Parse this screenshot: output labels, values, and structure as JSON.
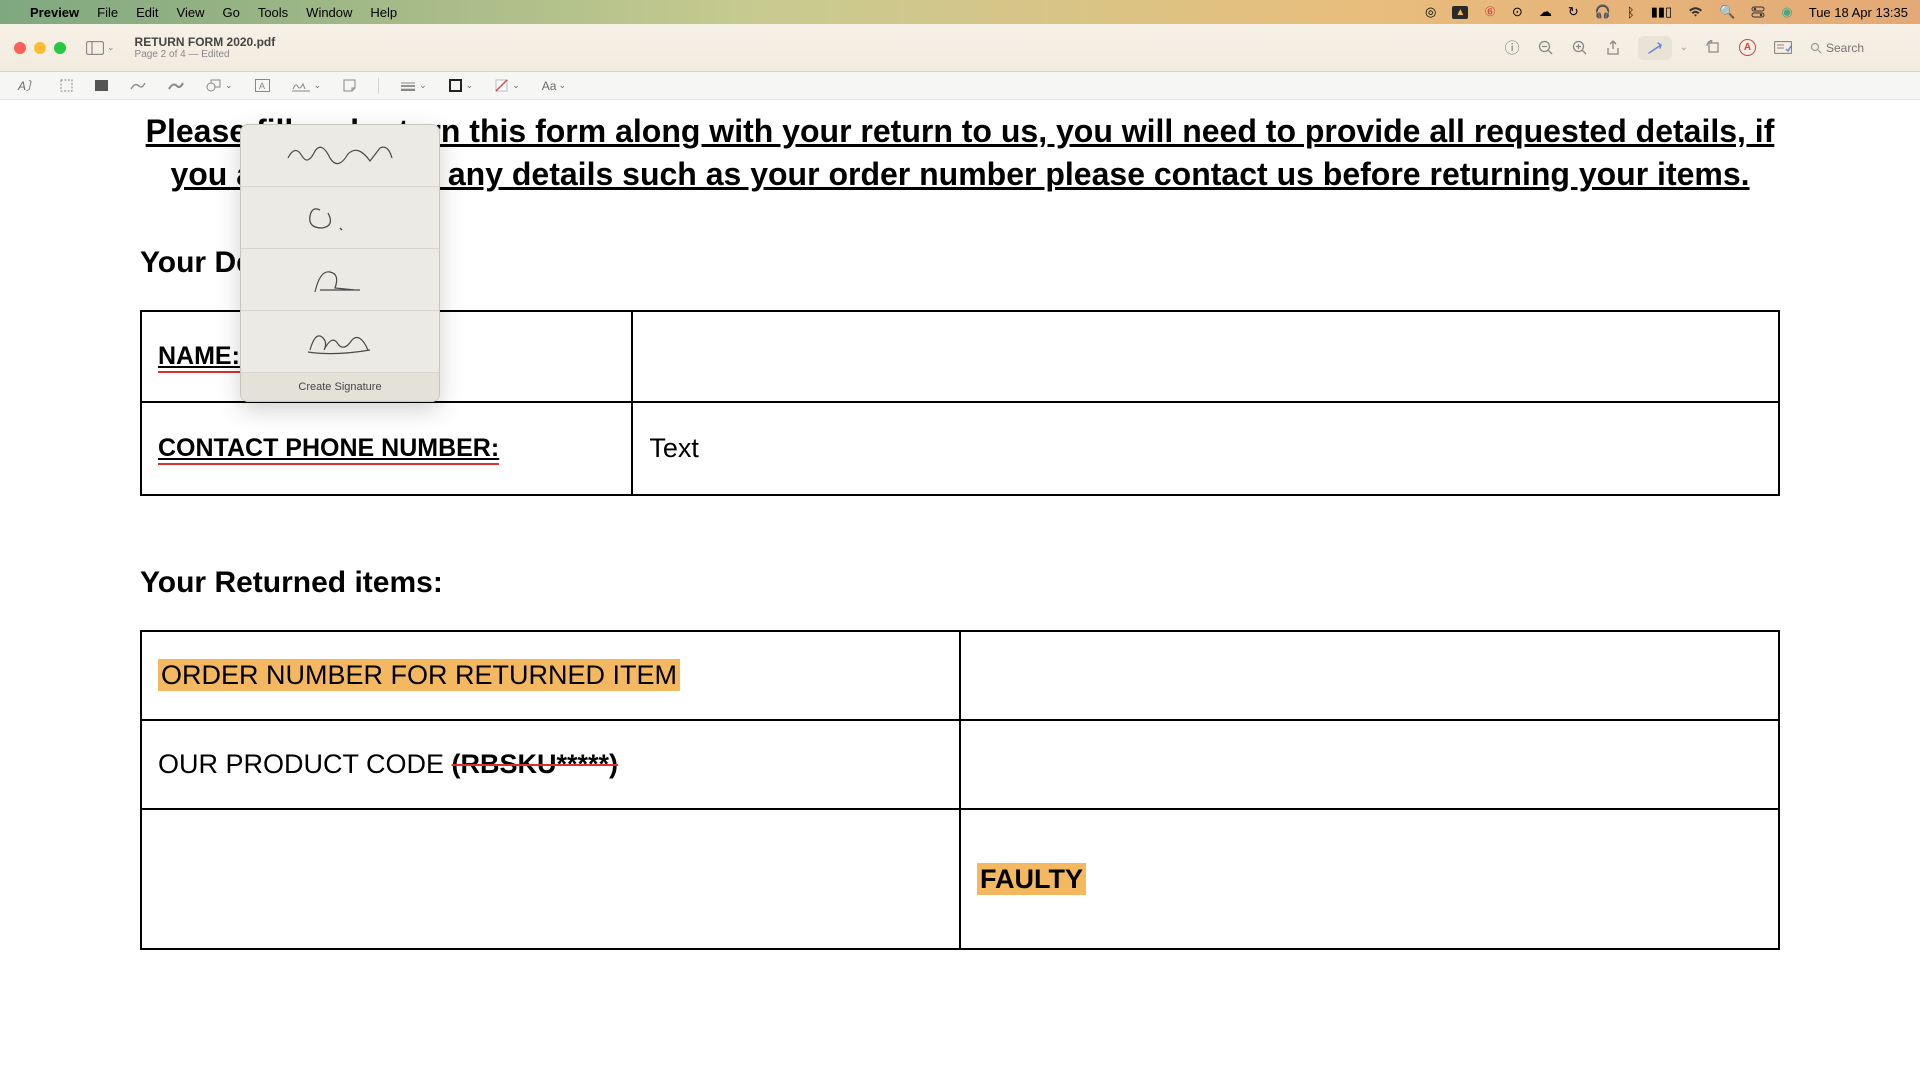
{
  "menubar": {
    "app": "Preview",
    "items": [
      "File",
      "Edit",
      "View",
      "Go",
      "Tools",
      "Window",
      "Help"
    ],
    "clock": "Tue 18 Apr  13:35"
  },
  "window": {
    "title": "RETURN FORM 2020.pdf",
    "subtitle": "Page 2 of 4 — Edited",
    "search_placeholder": "Search"
  },
  "signature": {
    "create_label": "Create Signature"
  },
  "doc": {
    "instruction": "Please fill and return this form along with your return to us, you will need to provide all requested details, if you are unsure of any details such as your order number please contact us before returning your items.",
    "details_heading": "Your Details:",
    "name_label": "NAME:",
    "phone_label": "CONTACT PHONE NUMBER:",
    "phone_value": "Text",
    "returned_heading": "Your Returned items:",
    "order_label": "ORDER NUMBER FOR RETURNED ITEM",
    "product_code_prefix": "OUR PRODUCT CODE ",
    "product_code_strike": "(RBSKU*****)",
    "faulty": "FAULTY"
  }
}
